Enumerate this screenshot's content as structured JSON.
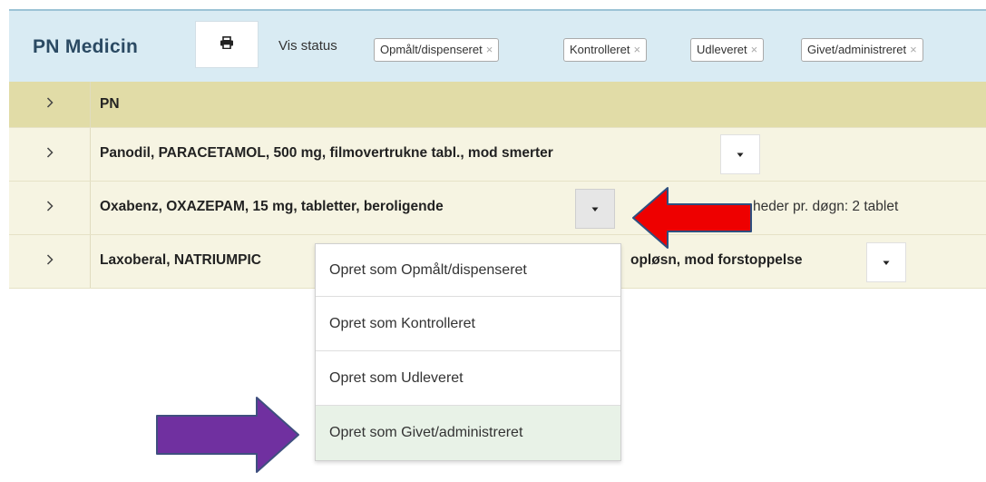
{
  "header": {
    "title": "PN Medicin",
    "print_icon": "printer-icon",
    "vis_status_label": "Vis status",
    "status_chips": [
      {
        "label": "Opmålt/dispenseret",
        "remove": "×"
      },
      {
        "label": "Kontrolleret",
        "remove": "×"
      },
      {
        "label": "Udleveret",
        "remove": "×"
      },
      {
        "label": "Givet/administreret",
        "remove": "×"
      }
    ]
  },
  "rows": [
    {
      "label": "PN"
    },
    {
      "label": "Panodil, PARACETAMOL, 500 mg, filmovertrukne tabl., mod smerter"
    },
    {
      "label": "Oxabenz, OXAZEPAM, 15 mg, tabletter, beroligende",
      "extra": "heder pr. døgn: 2 tablet"
    },
    {
      "label": "Laxoberal, NATRIUMPIC",
      "label_suffix": "opløsn, mod forstoppelse"
    }
  ],
  "dropdown_menu": {
    "items": [
      "Opret som Opmålt/dispenseret",
      "Opret som Kontrolleret",
      "Opret som Udleveret",
      "Opret som Givet/administreret"
    ]
  },
  "colors": {
    "header_bg": "#d9ebf3",
    "group_row_bg": "#e1dca7",
    "item_row_bg": "#f6f4e2",
    "highlight_item_bg": "#e8f2e7",
    "annotation_red": "#ee0000",
    "annotation_purple": "#7030a0"
  }
}
